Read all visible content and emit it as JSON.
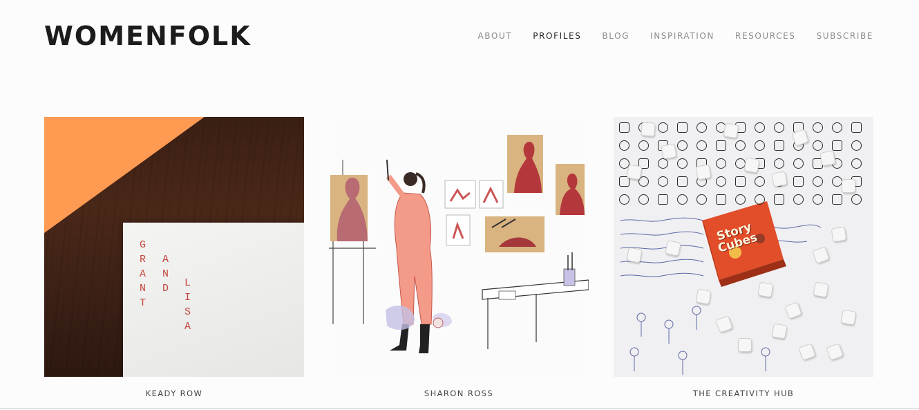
{
  "site": {
    "title": "WOMENFOLK"
  },
  "nav": {
    "items": [
      {
        "label": "ABOUT",
        "active": false
      },
      {
        "label": "PROFILES",
        "active": true
      },
      {
        "label": "BLOG",
        "active": false
      },
      {
        "label": "INSPIRATION",
        "active": false
      },
      {
        "label": "RESOURCES",
        "active": false
      },
      {
        "label": "SUBSCRIBE",
        "active": false
      }
    ]
  },
  "profiles": [
    {
      "caption": "KEADY ROW",
      "card_text": {
        "word1": [
          "G",
          "R",
          "A",
          "N",
          "T"
        ],
        "word2": [
          "A",
          "N",
          "D"
        ],
        "word3": [
          "L",
          "I",
          "S",
          "A"
        ]
      }
    },
    {
      "caption": "SHARON ROSS"
    },
    {
      "caption": "THE CREATIVITY HUB",
      "box_text": {
        "line1": "Story",
        "line2": "Cubes"
      }
    }
  ],
  "colors": {
    "accent_orange": "#ff9a52",
    "card_letter": "#c5463d",
    "box_orange": "#e24d2a",
    "nav_active": "#222222",
    "nav_inactive": "#8a8a8a"
  }
}
